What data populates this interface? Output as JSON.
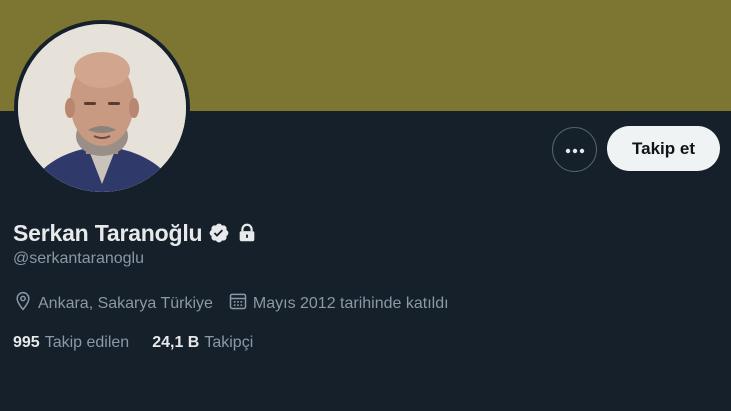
{
  "profile": {
    "display_name": "Serkan Taranoğlu",
    "handle": "@serkantaranoglu",
    "location": "Ankara, Sakarya Türkiye",
    "joined": "Mayıs 2012 tarihinde katıldı",
    "verified": true,
    "protected": true
  },
  "actions": {
    "follow_label": "Takip et",
    "more_icon": "more-dots-icon"
  },
  "stats": {
    "following_count": "995",
    "following_label": "Takip edilen",
    "followers_count": "24,1 B",
    "followers_label": "Takipçi"
  },
  "colors": {
    "banner": "#7c7632",
    "background": "#15202b",
    "muted_text": "#8b98a5",
    "button_bg": "#eff3f4"
  }
}
